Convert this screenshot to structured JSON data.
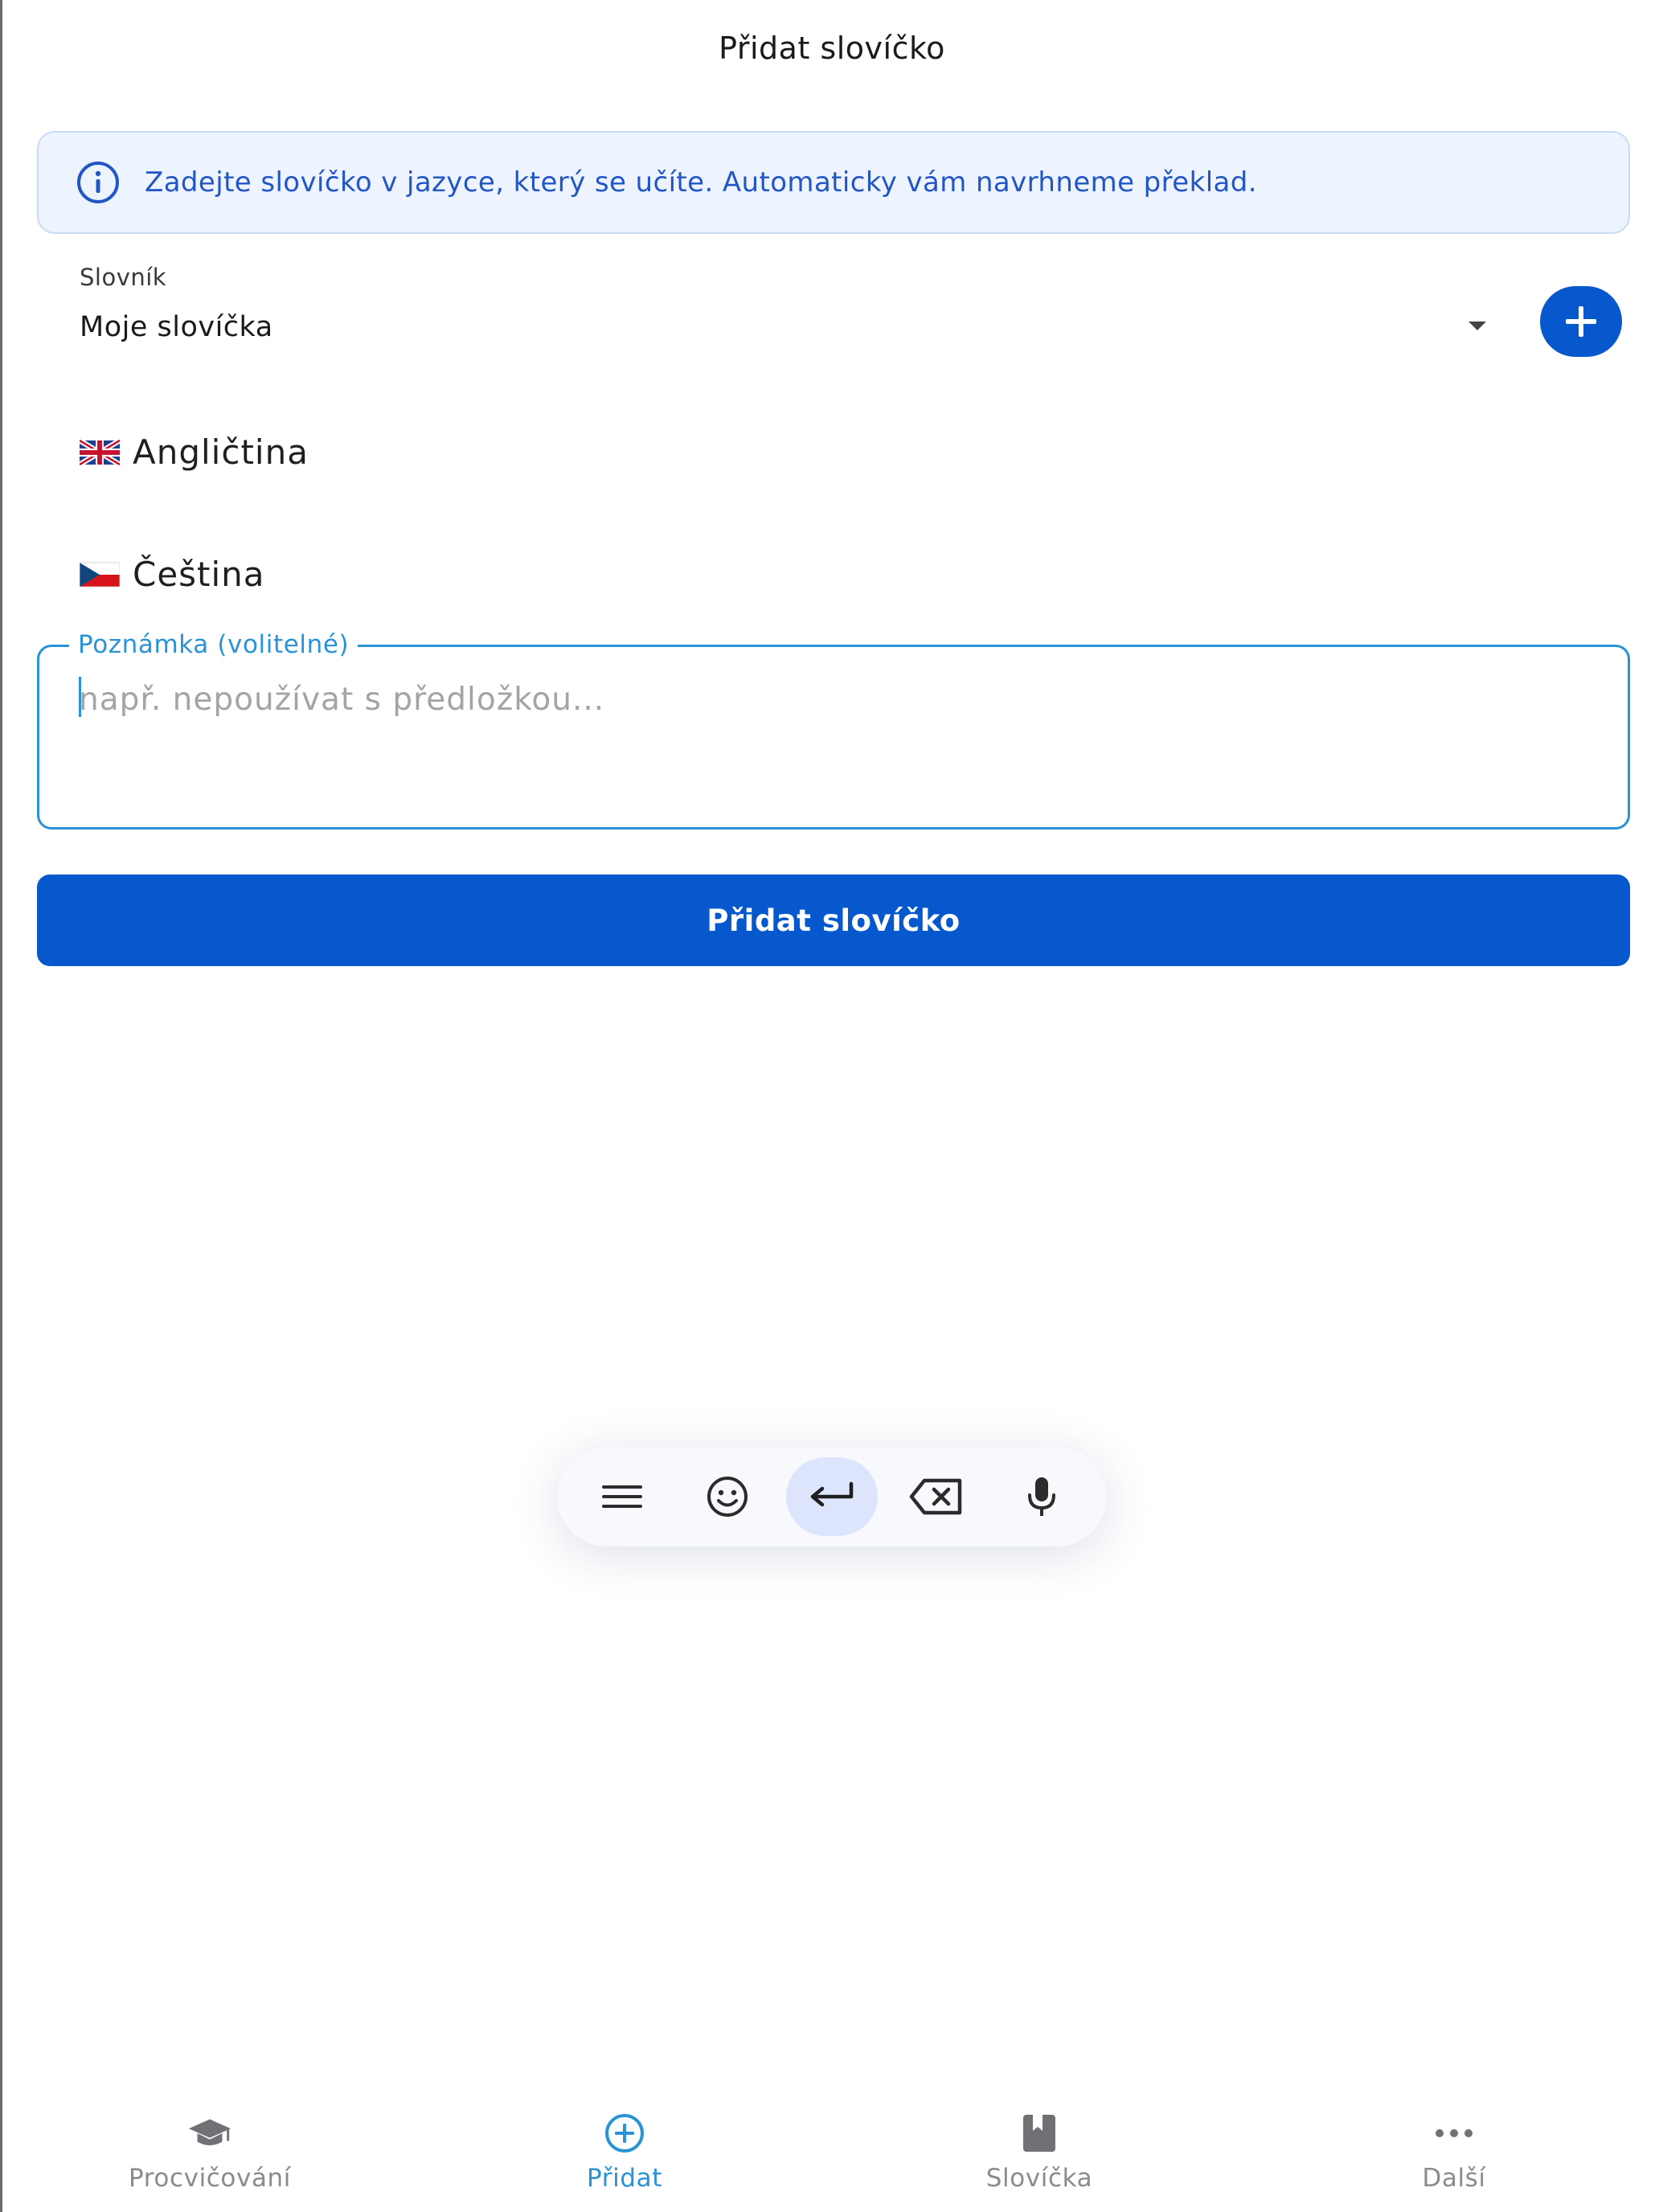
{
  "header": {
    "title": "Přidat slovíčko"
  },
  "info": {
    "text": "Zadejte slovíčko v jazyce, který se učíte. Automaticky vám navrhneme překlad.",
    "color": "#2356c5"
  },
  "dictionary": {
    "label": "Slovník",
    "selected": "Moje slovíčka",
    "add_icon": "plus-icon"
  },
  "languages": [
    {
      "flag": "gb-flag-icon",
      "label": "Angličtina"
    },
    {
      "flag": "cz-flag-icon",
      "label": "Čeština"
    }
  ],
  "note": {
    "label": "Poznámka (volitelné)",
    "placeholder": "např. nepoužívat s předložkou...",
    "value": ""
  },
  "submit": {
    "label": "Přidat slovíčko"
  },
  "keyboard_toolbar": {
    "icons": [
      "menu-icon",
      "emoji-icon",
      "enter-icon",
      "backspace-icon",
      "microphone-icon"
    ],
    "active": "enter-icon"
  },
  "bottom_nav": {
    "items": [
      {
        "label": "Procvičování",
        "icon": "graduation-cap-icon"
      },
      {
        "label": "Přidat",
        "icon": "plus-circle-icon",
        "active": true
      },
      {
        "label": "Slovíčka",
        "icon": "book-icon"
      },
      {
        "label": "Další",
        "icon": "more-icon"
      }
    ]
  },
  "colors": {
    "primary": "#0658cc",
    "accent": "#2a93d5",
    "info_bg": "#eef4fd"
  }
}
